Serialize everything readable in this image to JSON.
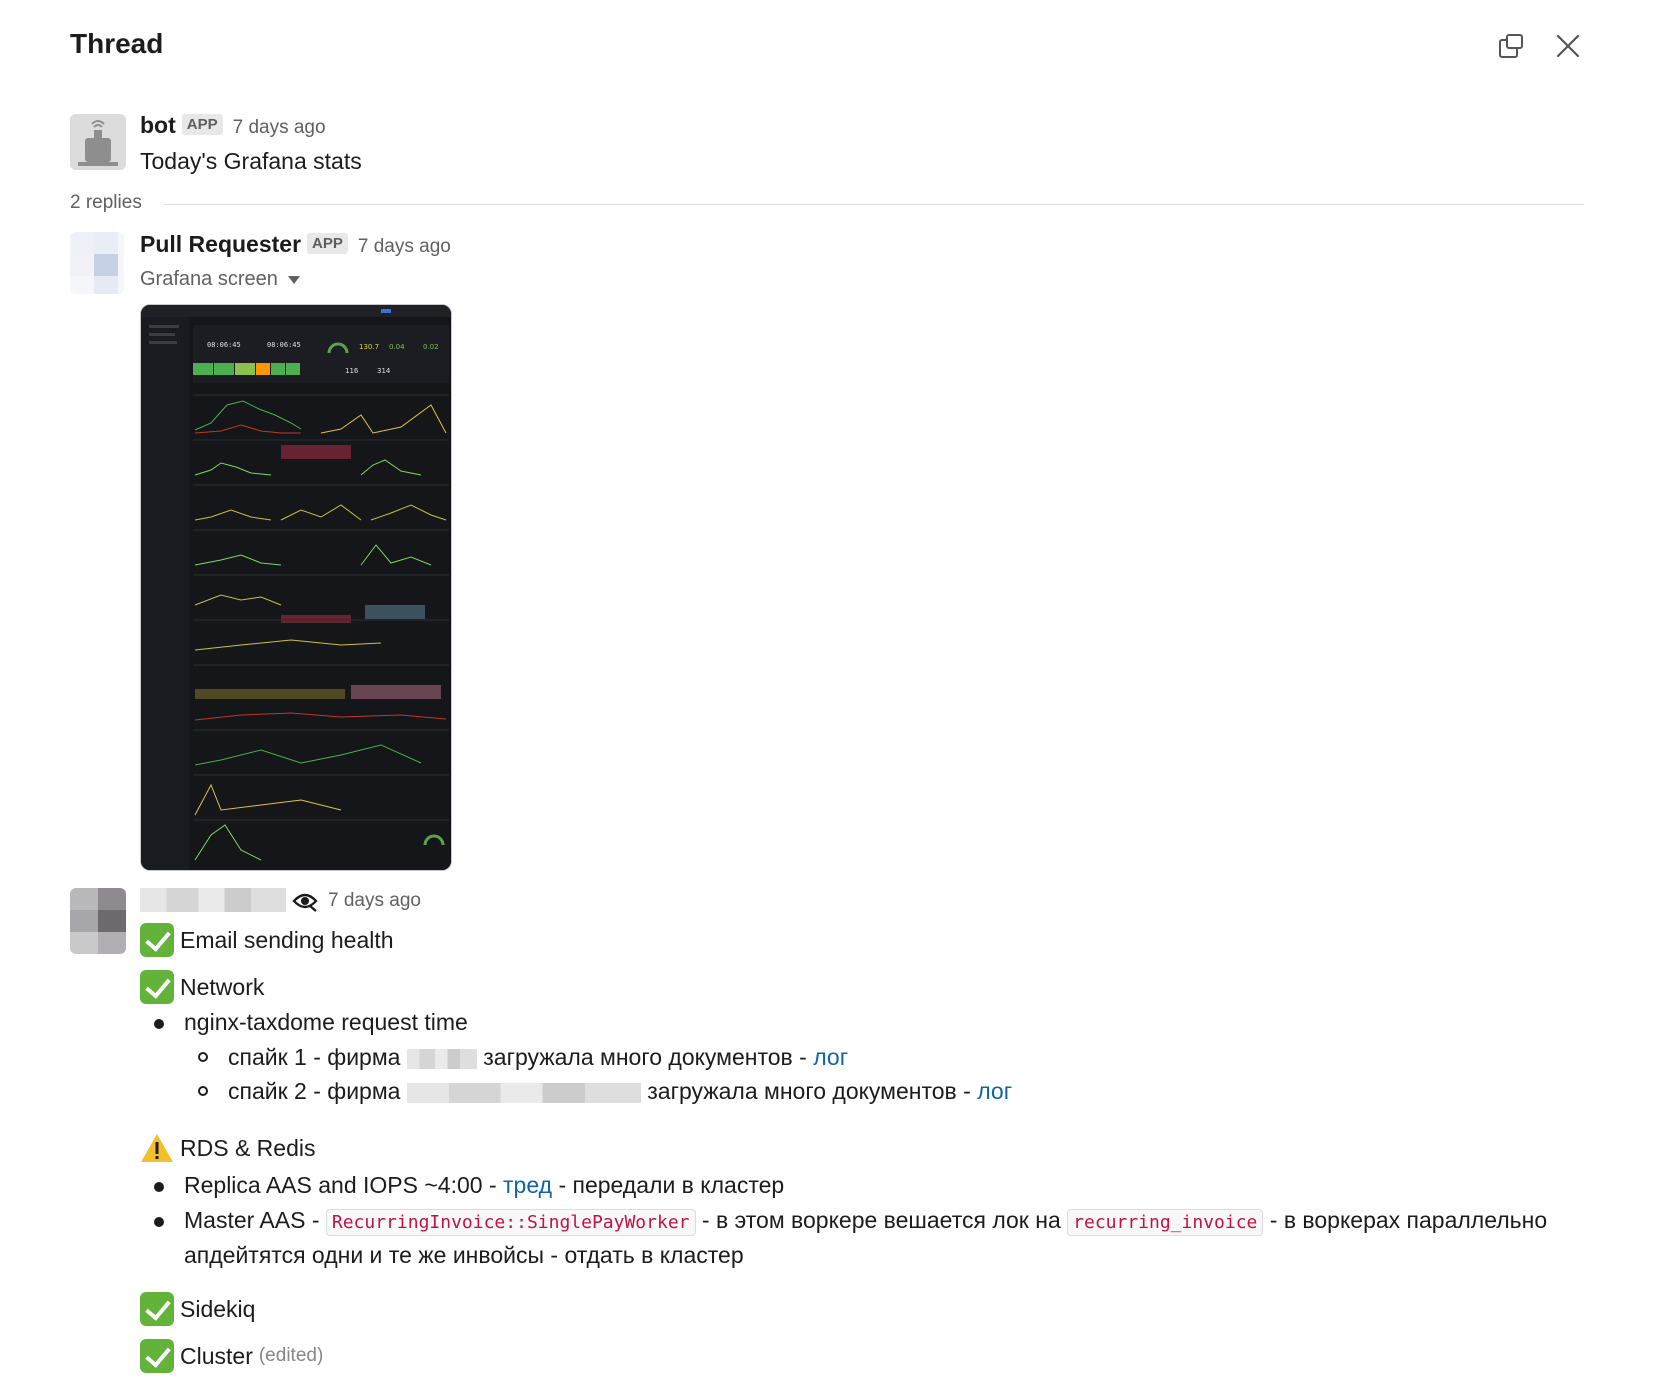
{
  "header": {
    "title": "Thread",
    "popout_icon": "popout-icon",
    "close_icon": "close-icon"
  },
  "parent": {
    "author": "bot",
    "badge": "APP",
    "timestamp": "7 days ago",
    "text": "Today's Grafana stats"
  },
  "replies_count": "2 replies",
  "reply1": {
    "author": "Pull Requester",
    "badge": "APP",
    "timestamp": "7 days ago",
    "file_label": "Grafana screen",
    "image_alt": "Grafana dashboard screenshot"
  },
  "reply2": {
    "timestamp": "7 days ago",
    "sections": {
      "email": "Email sending health",
      "network": "Network",
      "network_bullet": "nginx-taxdome request time",
      "spike1_pre": "спайк 1 - фирма",
      "spike1_post": "загружала много документов -",
      "spike2_pre": "спайк 2 - фирма",
      "spike2_post": "загружала много документов -",
      "log_link": "лог",
      "rds": "RDS & Redis",
      "replica_pre": "Replica AAS and IOPS ~4:00  -",
      "thread_link": "тред",
      "replica_post": "- передали в кластер",
      "master_pre": "Master AAS -",
      "code1": "RecurringInvoice::SinglePayWorker",
      "master_mid": "- в этом воркере вешается лок на",
      "code2": "recurring_invoice",
      "master_post": "- в воркерах параллельно",
      "master_line2": "апдейтятся одни и те же инвойсы - отдать в кластер",
      "sidekiq": "Sidekiq",
      "cluster": "Cluster",
      "edited": "(edited)"
    }
  },
  "colors": {
    "link": "#1264a3",
    "check": "#63b33b",
    "code": "#c01343"
  }
}
